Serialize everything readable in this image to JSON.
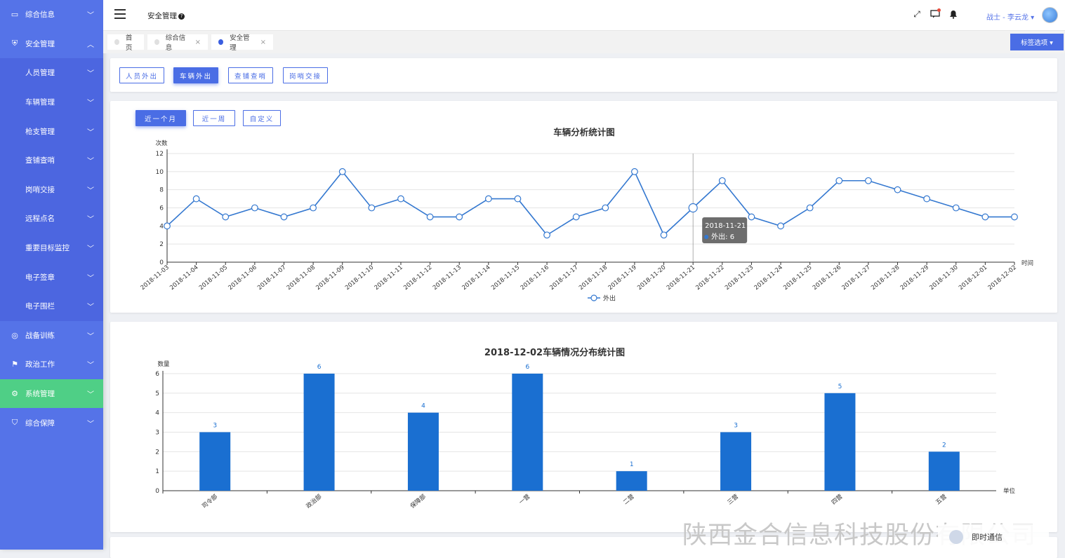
{
  "sidebar": {
    "items": [
      {
        "label": "综合信息",
        "icon": "monitor-icon",
        "chev": "⌄"
      },
      {
        "label": "安全管理",
        "icon": "shield-icon",
        "chev": "⌃"
      },
      {
        "label": "人员管理",
        "chev": "⌄"
      },
      {
        "label": "车辆管理",
        "chev": "⌄"
      },
      {
        "label": "枪支管理",
        "chev": "⌄"
      },
      {
        "label": "查铺查哨",
        "chev": "⌄"
      },
      {
        "label": "岗哨交接",
        "chev": "⌄"
      },
      {
        "label": "远程点名",
        "chev": "⌄"
      },
      {
        "label": "重要目标监控",
        "chev": "⌄"
      },
      {
        "label": "电子签章",
        "chev": "⌄"
      },
      {
        "label": "电子围栏",
        "chev": "⌄"
      },
      {
        "label": "战备训练",
        "icon": "target-icon",
        "chev": "⌄"
      },
      {
        "label": "政治工作",
        "icon": "flag-icon",
        "chev": "⌄"
      },
      {
        "label": "系统管理",
        "icon": "gear-icon",
        "chev": "⌄"
      },
      {
        "label": "综合保障",
        "icon": "badge-icon",
        "chev": "⌄"
      }
    ]
  },
  "header": {
    "title": "安全管理",
    "help": "?",
    "user": "战士 - 李云龙 ▾",
    "icons": [
      "fullscreen-icon",
      "message-icon",
      "bell-icon"
    ]
  },
  "tabs": [
    {
      "label": "首页"
    },
    {
      "label": "综合信息",
      "close": "×"
    },
    {
      "label": "安全管理",
      "close": "×"
    }
  ],
  "tab_options": "标签选项 ▾",
  "type_buttons": [
    "人员外出",
    "车辆外出",
    "查铺查哨",
    "岗哨交接"
  ],
  "range_buttons": [
    "近一个月",
    "近一周",
    "自定义"
  ],
  "colors": {
    "accent": "#4a6de5",
    "sidebar": "#5573e8",
    "active_menu": "#4fcf86",
    "line": "#3478d0",
    "bar": "#1a6fd1"
  },
  "chart_data": [
    {
      "type": "line",
      "title": "车辆分析统计图",
      "ylabel": "次数",
      "xlabel": "时间",
      "ylim": [
        0,
        12
      ],
      "yticks": [
        0,
        2,
        4,
        6,
        8,
        10,
        12
      ],
      "grid": true,
      "legend": "bottom",
      "categories": [
        "2018-11-03",
        "2018-11-04",
        "2018-11-05",
        "2018-11-06",
        "2018-11-07",
        "2018-11-08",
        "2018-11-09",
        "2018-11-10",
        "2018-11-11",
        "2018-11-12",
        "2018-11-13",
        "2018-11-14",
        "2018-11-15",
        "2018-11-16",
        "2018-11-17",
        "2018-11-18",
        "2018-11-19",
        "2018-11-20",
        "2018-11-21",
        "2018-11-22",
        "2018-11-23",
        "2018-11-24",
        "2018-11-25",
        "2018-11-26",
        "2018-11-27",
        "2018-11-28",
        "2018-11-29",
        "2018-11-30",
        "2018-12-01",
        "2018-12-02"
      ],
      "series": [
        {
          "name": "外出",
          "values": [
            4,
            7,
            5,
            6,
            5,
            6,
            10,
            6,
            7,
            5,
            5,
            7,
            7,
            3,
            5,
            6,
            10,
            3,
            6,
            9,
            5,
            4,
            6,
            9,
            9,
            8,
            7,
            6,
            5,
            5
          ]
        }
      ],
      "tooltip": {
        "date": "2018-11-21",
        "text": "外出: 6"
      }
    },
    {
      "type": "bar",
      "title": "2018-12-02车辆情况分布统计图",
      "ylabel": "数量",
      "xlabel": "单位",
      "ylim": [
        0,
        6
      ],
      "yticks": [
        0,
        1,
        2,
        3,
        4,
        5,
        6
      ],
      "grid": true,
      "categories": [
        "司令部",
        "政治部",
        "保障部",
        "一营",
        "二营",
        "三营",
        "四营",
        "五营"
      ],
      "values": [
        3,
        6,
        4,
        6,
        1,
        3,
        5,
        2
      ]
    }
  ],
  "watermark": "陕西金合信息科技股份有限公司",
  "chat": "即时通信"
}
